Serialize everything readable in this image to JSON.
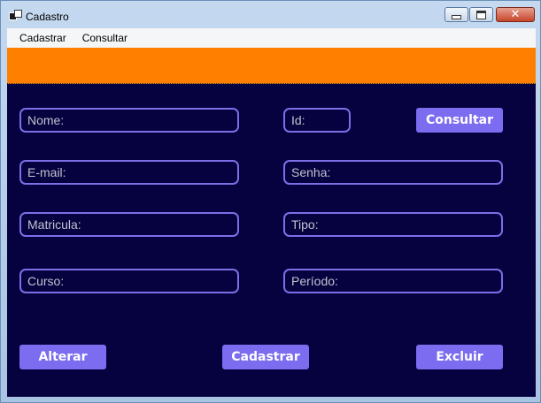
{
  "window": {
    "title": "Cadastro"
  },
  "menu": {
    "items": [
      "Cadastrar",
      "Consultar"
    ]
  },
  "form": {
    "nome_placeholder": "Nome:",
    "id_placeholder": "Id:",
    "email_placeholder": "E-mail:",
    "senha_placeholder": "Senha:",
    "matricula_placeholder": "Matricula:",
    "tipo_placeholder": "Tipo:",
    "curso_placeholder": "Curso:",
    "periodo_placeholder": "Período:"
  },
  "buttons": {
    "consultar": "Consultar",
    "alterar": "Alterar",
    "cadastrar": "Cadastrar",
    "excluir": "Excluir"
  },
  "colors": {
    "background": "#06023f",
    "banner": "#ff8000",
    "accent": "#7b6cf0"
  },
  "icons": {
    "app": "app-window-icon",
    "minimize": "minimize-icon",
    "maximize": "maximize-icon",
    "close": "close-icon"
  }
}
